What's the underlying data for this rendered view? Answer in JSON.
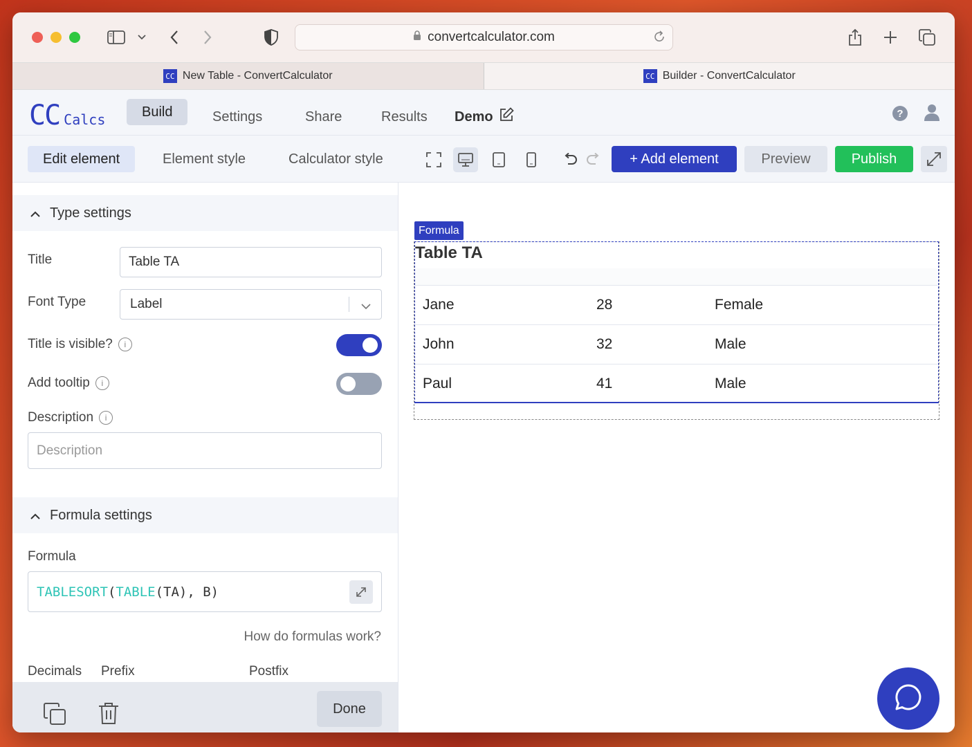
{
  "browser": {
    "url": "convertcalculator.com",
    "tabs": [
      {
        "favicon": "CC",
        "title": "New Table - ConvertCalculator"
      },
      {
        "favicon": "CC",
        "title": "Builder - ConvertCalculator"
      }
    ]
  },
  "app": {
    "logo_cc": "CC",
    "logo_calcs": "Calcs",
    "nav": [
      "Build",
      "Settings",
      "Share",
      "Results"
    ],
    "project": "Demo"
  },
  "editor": {
    "tabs": [
      "Edit element",
      "Element style",
      "Calculator style"
    ],
    "add_element": "+ Add element",
    "preview": "Preview",
    "publish": "Publish"
  },
  "panel": {
    "type_settings": {
      "heading": "Type settings",
      "title_label": "Title",
      "title_value": "Table TA",
      "font_type_label": "Font Type",
      "font_type_value": "Label",
      "title_visible_label": "Title is visible?",
      "title_visible": true,
      "tooltip_label": "Add tooltip",
      "tooltip": false,
      "description_label": "Description",
      "description_placeholder": "Description"
    },
    "formula_settings": {
      "heading": "Formula settings",
      "formula_label": "Formula",
      "formula_fn1": "TABLESORT",
      "formula_p1": "(",
      "formula_fn2": "TABLE",
      "formula_rest": "(TA), B)",
      "help_link": "How do formulas work?",
      "decimals_label": "Decimals",
      "prefix_label": "Prefix",
      "postfix_label": "Postfix"
    },
    "done": "Done"
  },
  "canvas": {
    "badge": "Formula",
    "table_title": "Table TA",
    "rows": [
      [
        "Jane",
        "28",
        "Female"
      ],
      [
        "John",
        "32",
        "Male"
      ],
      [
        "Paul",
        "41",
        "Male"
      ]
    ]
  },
  "colors": {
    "brand": "#2f3fbf",
    "publish": "#22c05a",
    "formula_fn": "#2ec4b6"
  }
}
